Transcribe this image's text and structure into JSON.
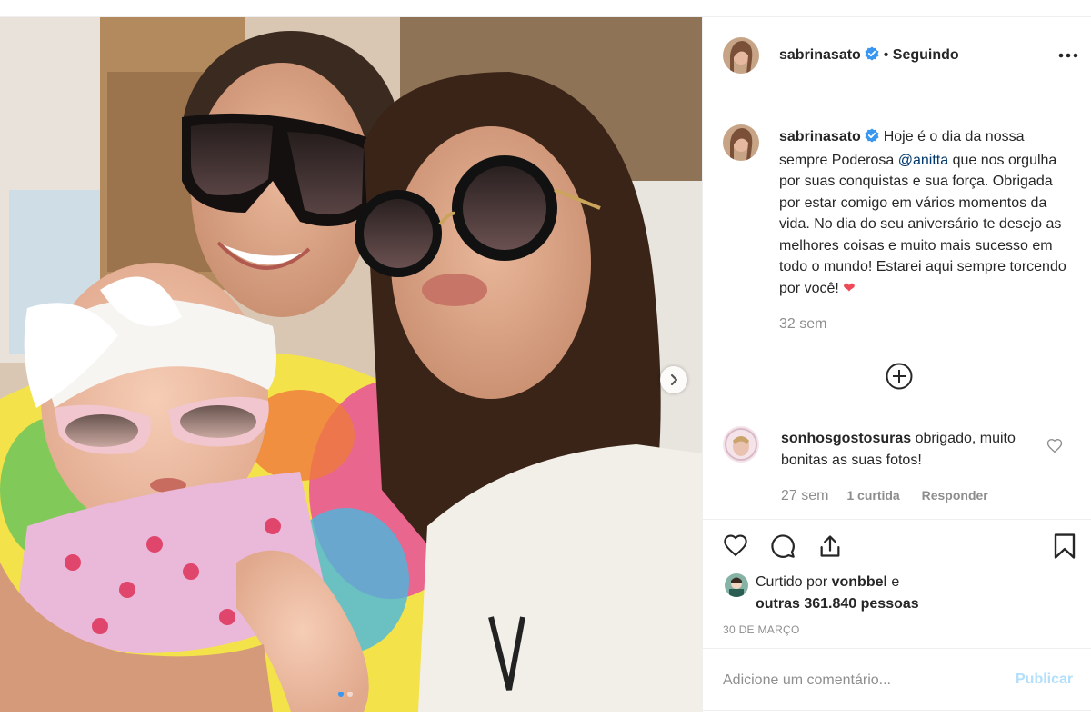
{
  "post": {
    "author": "sabrinasato",
    "following_label": "Seguindo",
    "separator": "•"
  },
  "caption": {
    "author": "sabrinasato",
    "text_before": "Hoje é o dia da nossa sempre Poderosa ",
    "mention": "@anitta",
    "text_after": " que nos orgulha por suas conquistas e sua força. Obrigada por estar comigo em vários momentos da vida. No dia do seu aniversário te desejo as melhores coisas e muito mais sucesso em todo o mundo! Estarei aqui sempre torcendo por você! ",
    "emoji": "❤",
    "time": "32 sem"
  },
  "comments": [
    {
      "author": "sonhosgostosuras",
      "text": "obrigado, muito bonitas as suas fotos!",
      "time": "27 sem",
      "likes": "1 curtida",
      "reply": "Responder"
    }
  ],
  "likes": {
    "prefix": "Curtido por",
    "first_user": "vonbbel",
    "conjunction": "e",
    "others": "outras 361.840 pessoas"
  },
  "date": "30 DE MARÇO",
  "comment_input": {
    "placeholder": "Adicione um comentário...",
    "submit": "Publicar"
  },
  "carousel": {
    "total_slides": 2,
    "active_slide": 1
  },
  "colors": {
    "verified": "#3897f0",
    "mention": "#00376b",
    "publish_disabled": "#b2dffc",
    "heart": "#ed4956"
  },
  "icons": {
    "header": [
      "verified-badge-icon",
      "more-options-icon"
    ],
    "actions": [
      "heart-icon",
      "comment-icon",
      "share-icon",
      "bookmark-icon"
    ],
    "other": [
      "plus-circle-icon",
      "chevron-right-icon",
      "small-heart-icon"
    ]
  }
}
